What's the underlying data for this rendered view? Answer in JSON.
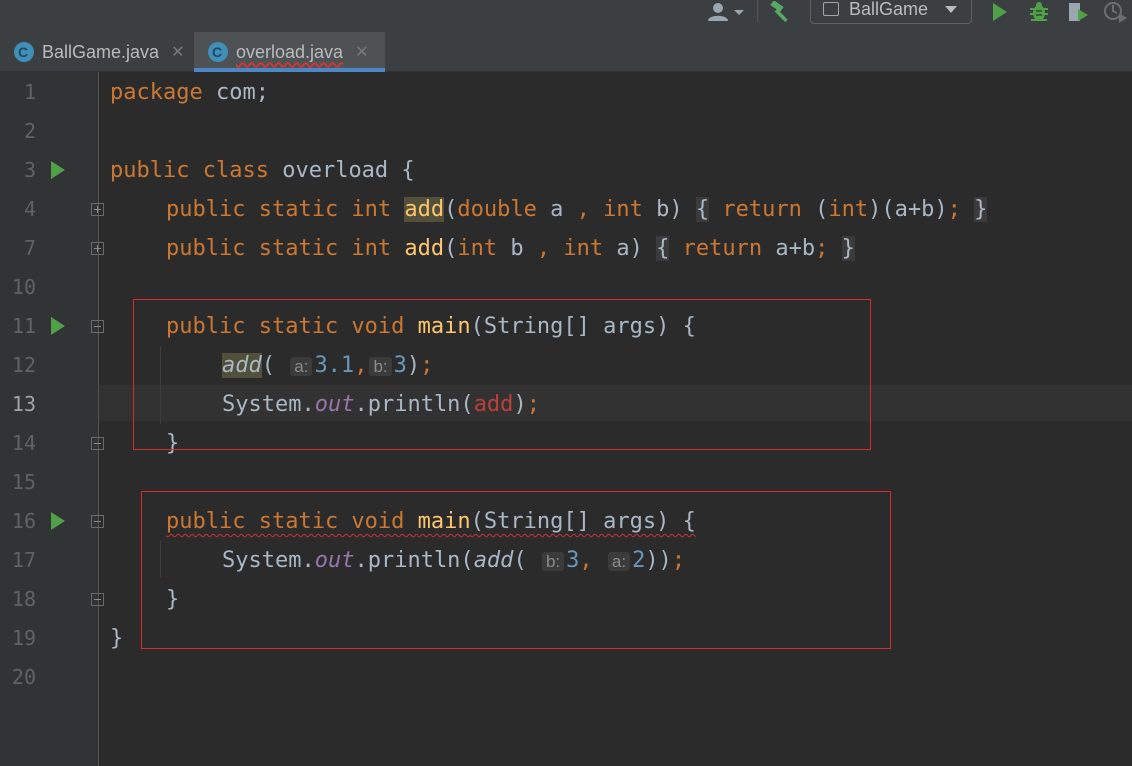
{
  "toolbar": {
    "run_config_label": "BallGame",
    "icons": [
      "user-icon",
      "hammer-icon",
      "run-config-icon",
      "run-icon",
      "debug-icon",
      "coverage-icon",
      "profile-icon"
    ]
  },
  "tabs": [
    {
      "label": "BallGame.java",
      "close": "✕",
      "active": false
    },
    {
      "label": "overload.java",
      "close": "✕",
      "active": true
    }
  ],
  "editor": {
    "line_numbers": [
      "1",
      "2",
      "3",
      "4",
      "7",
      "10",
      "11",
      "12",
      "13",
      "14",
      "15",
      "16",
      "17",
      "18",
      "19",
      "20"
    ],
    "current_line": "13",
    "colors": {
      "keyword": "#cc7832",
      "function": "#ffc66d",
      "number": "#6897bb",
      "field": "#9876aa",
      "error": "#bc3f3c",
      "text": "#a9b7c6",
      "run_marker": "#4fa046",
      "box": "#d62c2c"
    },
    "code": {
      "l1": {
        "kw": "package",
        "rest": " com;"
      },
      "l3": {
        "kw1": "public",
        "kw2": "class",
        "rest": " overload {"
      },
      "l4": {
        "mods": "public static int",
        "name": "add",
        "p_open": "(",
        "t1": "double",
        "a": " a ",
        "comma": ",",
        "t2": " int",
        "b": " b)",
        "brace_o": "{",
        "ret": "return",
        "cast_o": " (",
        "cast_t": "int",
        "cast_rest": ")(a+b)",
        "semi": ";",
        "brace_c": "}"
      },
      "l7": {
        "mods": "public static int",
        "name": "add",
        "p_open": "(",
        "t1": "int",
        "b": " b ",
        "comma": ",",
        "t2": " int",
        "a": " a)",
        "brace_o": "{",
        "ret": "return",
        "expr": " a+b",
        "semi": ";",
        "brace_c": "}"
      },
      "l11": {
        "mods": "public static void",
        "name": "main",
        "rest": "(String[] args) {"
      },
      "l12": {
        "call": "add",
        "p_open": "(",
        "hint_a": "a:",
        "v1": "3.1",
        "comma": ",",
        "hint_b": "b:",
        "v2": "3",
        "close": ")",
        "semi": ";"
      },
      "l13": {
        "obj": "System.",
        "field": "out",
        "meth": ".println(",
        "arg": "add",
        "close": ")",
        "semi": ";"
      },
      "l14": {
        "brace": "}"
      },
      "l16": {
        "mods": "public static void",
        "name": "main",
        "rest": "(String[] args) {"
      },
      "l17": {
        "obj": "System.",
        "field": "out",
        "meth": ".println(",
        "call": "add",
        "p_open": "(",
        "hint_b": "b:",
        "v1": "3",
        "comma": ",",
        "hint_a": "a:",
        "v2": "2",
        "close": "))",
        "semi": ";"
      },
      "l18": {
        "brace": "}"
      },
      "l19": {
        "brace": "}"
      }
    }
  }
}
